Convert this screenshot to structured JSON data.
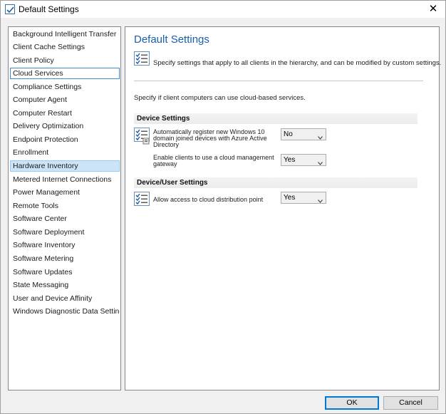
{
  "window": {
    "title": "Default Settings",
    "close_glyph": "✕"
  },
  "nav": {
    "items": [
      "Background Intelligent Transfer",
      "Client Cache Settings",
      "Client Policy",
      "Cloud Services",
      "Compliance Settings",
      "Computer Agent",
      "Computer Restart",
      "Delivery Optimization",
      "Endpoint Protection",
      "Enrollment",
      "Hardware Inventory",
      "Metered Internet Connections",
      "Power Management",
      "Remote Tools",
      "Software Center",
      "Software Deployment",
      "Software Inventory",
      "Software Metering",
      "Software Updates",
      "State Messaging",
      "User and Device Affinity",
      "Windows Diagnostic Data Settings"
    ],
    "focused_item": "Cloud Services",
    "selected_item": "Hardware Inventory"
  },
  "content": {
    "title": "Default Settings",
    "intro": "Specify settings that apply to all clients in the hierarchy, and can be modified by custom settings.",
    "subtitle": "Specify if client computers can use cloud-based services.",
    "groups": [
      {
        "heading": "Device Settings",
        "settings": [
          {
            "label": "Automatically register new Windows 10 domain joined devices with Azure Active Directory",
            "value": "No"
          },
          {
            "label": "Enable clients to use a cloud management gateway",
            "value": "Yes"
          }
        ]
      },
      {
        "heading": "Device/User Settings",
        "settings": [
          {
            "label": "Allow access to cloud distribution point",
            "value": "Yes"
          }
        ]
      }
    ]
  },
  "buttons": {
    "ok": "OK",
    "cancel": "Cancel"
  },
  "colors": {
    "title_blue": "#1a5fa8",
    "selection": "#cce4f7",
    "focus_border": "#3d8ad6"
  },
  "icons": {
    "title": "settings-checklist-icon",
    "settings": "checklist-icon",
    "select": "chevron-down-icon",
    "close": "close-icon"
  }
}
